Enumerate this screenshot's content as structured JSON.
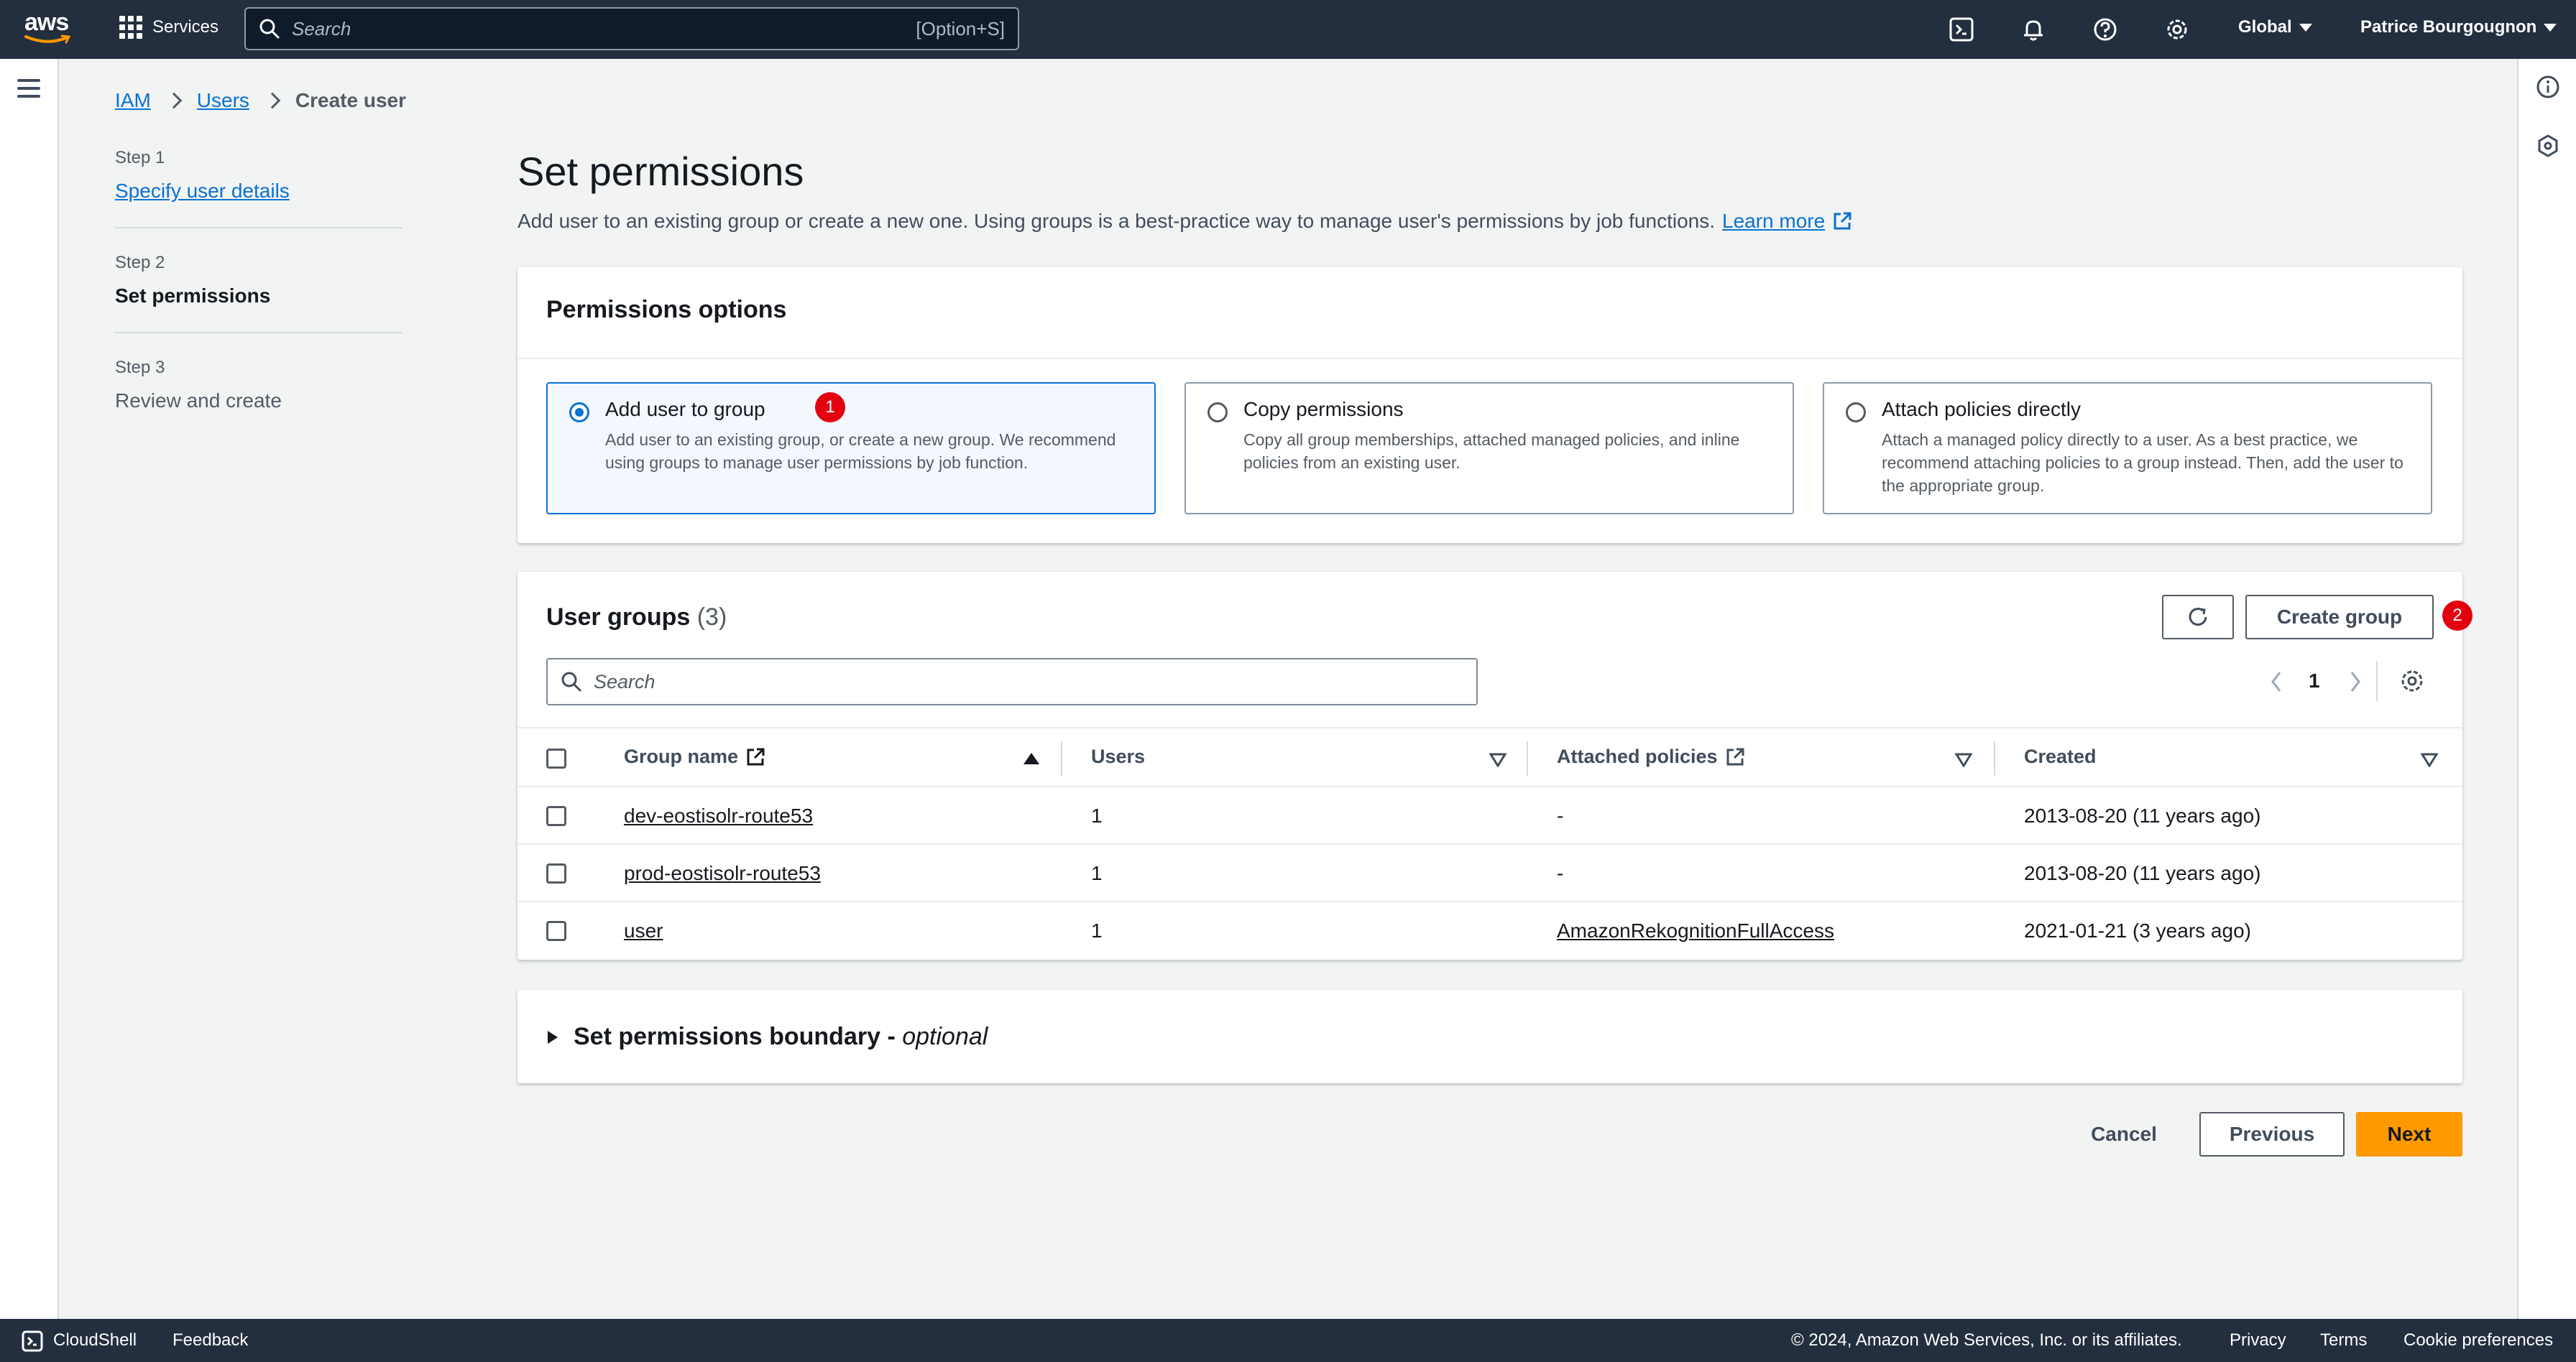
{
  "topnav": {
    "logo_text": "aws",
    "services_label": "Services",
    "search_placeholder": "Search",
    "search_shortcut": "[Option+S]",
    "region_label": "Global",
    "user_label": "Patrice Bourgougnon",
    "icons": [
      "cloudshell-icon",
      "bell-icon",
      "help-icon",
      "settings-icon"
    ]
  },
  "breadcrumb": {
    "items": [
      "IAM",
      "Users"
    ],
    "current": "Create user"
  },
  "steps": [
    {
      "num": "Step 1",
      "label": "Specify user details"
    },
    {
      "num": "Step 2",
      "label": "Set permissions"
    },
    {
      "num": "Step 3",
      "label": "Review and create"
    }
  ],
  "page": {
    "title": "Set permissions",
    "description": "Add user to an existing group or create a new one. Using groups is a best-practice way to manage user's permissions by job functions.",
    "learn_more": "Learn more"
  },
  "permissions_options": {
    "heading": "Permissions options",
    "options": [
      {
        "title": "Add user to group",
        "desc": "Add user to an existing group, or create a new group. We recommend using groups to manage user permissions by job function.",
        "selected": true
      },
      {
        "title": "Copy permissions",
        "desc": "Copy all group memberships, attached managed policies, and inline policies from an existing user.",
        "selected": false
      },
      {
        "title": "Attach policies directly",
        "desc": "Attach a managed policy directly to a user. As a best practice, we recommend attaching policies to a group instead. Then, add the user to the appropriate group.",
        "selected": false
      }
    ]
  },
  "badges": [
    "1",
    "2"
  ],
  "user_groups": {
    "heading": "User groups",
    "count": "(3)",
    "create_button": "Create group",
    "search_placeholder": "Search",
    "page_number": "1",
    "columns": [
      "Group name",
      "Users",
      "Attached policies",
      "Created"
    ],
    "rows": [
      {
        "name": "dev-eostisolr-route53",
        "users": "1",
        "policies": "-",
        "created": "2013-08-20 (11 years ago)"
      },
      {
        "name": "prod-eostisolr-route53",
        "users": "1",
        "policies": "-",
        "created": "2013-08-20 (11 years ago)"
      },
      {
        "name": "user",
        "users": "1",
        "policies": "AmazonRekognitionFullAccess",
        "created": "2021-01-21 (3 years ago)"
      }
    ]
  },
  "boundary": {
    "title": "Set permissions boundary - ",
    "optional": "optional"
  },
  "actions": {
    "cancel": "Cancel",
    "previous": "Previous",
    "next": "Next"
  },
  "footer": {
    "cloudshell": "CloudShell",
    "feedback": "Feedback",
    "copyright": "© 2024, Amazon Web Services, Inc. or its affiliates.",
    "privacy": "Privacy",
    "terms": "Terms",
    "cookie": "Cookie preferences"
  },
  "colors": {
    "nav_bg": "#232f3e",
    "link": "#0972d3",
    "primary": "#ff9900",
    "badge": "#e3000f"
  }
}
